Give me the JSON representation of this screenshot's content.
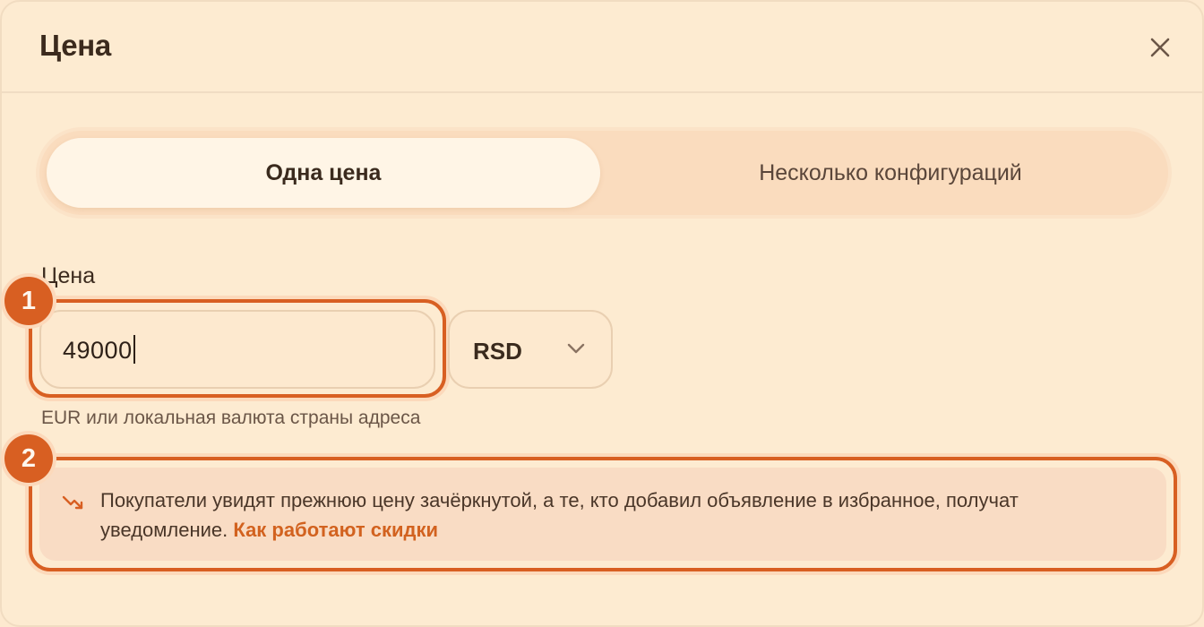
{
  "dialog": {
    "title": "Цена",
    "close_icon": "close-icon"
  },
  "pricing_mode": {
    "options": [
      {
        "label": "Одна цена",
        "selected": true
      },
      {
        "label": "Несколько конфигураций",
        "selected": false
      }
    ]
  },
  "price_field": {
    "label": "Цена",
    "value": "49000",
    "currency": "RSD",
    "helper": "EUR или локальная валюта страны адреса"
  },
  "discount_notice": {
    "icon": "trend-down-icon",
    "text": "Покупатели увидят прежнюю цену зачёркнутой, а те, кто добавил объявление в избранное, получат уведомление. ",
    "link_label": "Как работают скидки"
  },
  "annotations": {
    "badge_1": "1",
    "badge_2": "2"
  },
  "colors": {
    "accent": "#d85f22",
    "background": "#fdebd1",
    "link": "#d2621f"
  }
}
